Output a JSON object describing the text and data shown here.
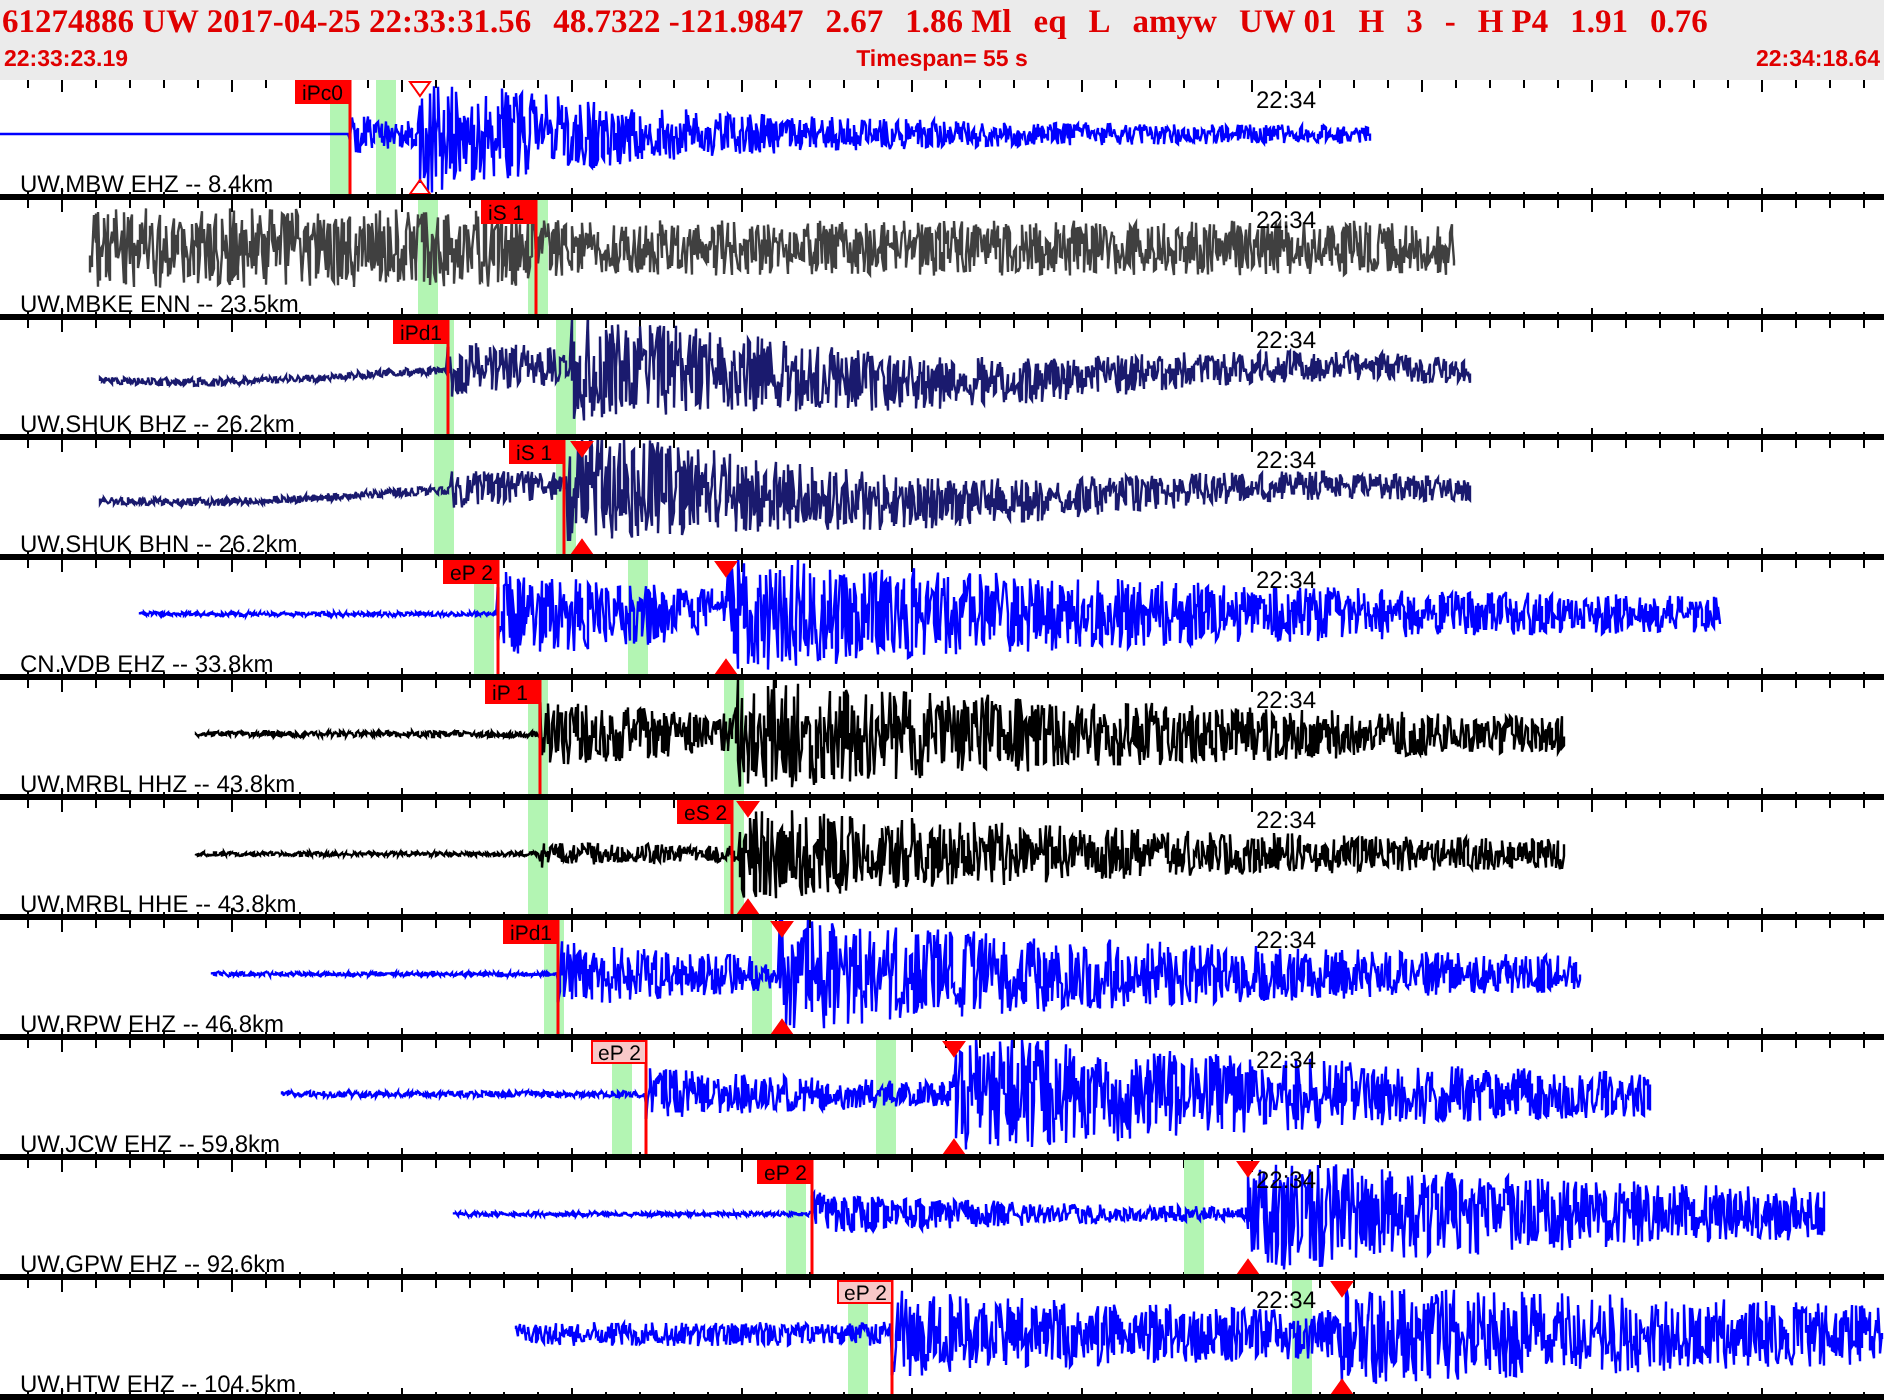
{
  "header": {
    "fields": [
      "61274886 UW 2017-04-25 22:33:31.56",
      "48.7322 -121.9847",
      "2.67",
      "1.86 Ml",
      "eq",
      "L",
      "amyw",
      "UW 01",
      "H",
      "3",
      "-",
      "H P4",
      "1.91",
      "0.76"
    ],
    "start_time": "22:33:23.19",
    "timespan": "Timespan=  55 s",
    "end_time": "22:34:18.64"
  },
  "traces": [
    {
      "station": "UW.MBW EHZ -- 8.4km",
      "time_label": "22:34",
      "color": "#0000ff",
      "pick": {
        "label": "iPc0",
        "kind": "solid"
      }
    },
    {
      "station": "UW.MBKE ENN -- 23.5km",
      "time_label": "22:34",
      "color": "#404040",
      "pick": {
        "label": "iS 1",
        "kind": "solid"
      }
    },
    {
      "station": "UW.SHUK BHZ -- 26.2km",
      "time_label": "22:34",
      "color": "#1a1a6e",
      "pick": {
        "label": "iPd1",
        "kind": "solid"
      }
    },
    {
      "station": "UW.SHUK BHN -- 26.2km",
      "time_label": "22:34",
      "color": "#1a1a6e",
      "pick": {
        "label": "iS 1",
        "kind": "solid"
      }
    },
    {
      "station": "CN.VDB EHZ -- 33.8km",
      "time_label": "22:34",
      "color": "#0000ff",
      "pick": {
        "label": "eP 2",
        "kind": "solid"
      }
    },
    {
      "station": "UW.MRBL HHZ -- 43.8km",
      "time_label": "22:34",
      "color": "#000000",
      "pick": {
        "label": "iP 1",
        "kind": "solid"
      }
    },
    {
      "station": "UW.MRBL HHE -- 43.8km",
      "time_label": "22:34",
      "color": "#000000",
      "pick": {
        "label": "eS 2",
        "kind": "solid"
      }
    },
    {
      "station": "UW.RPW EHZ -- 46.8km",
      "time_label": "22:34",
      "color": "#0000ff",
      "pick": {
        "label": "iPd1",
        "kind": "solid"
      }
    },
    {
      "station": "UW.JCW EHZ -- 59.8km",
      "time_label": "22:34",
      "color": "#0000ff",
      "pick": {
        "label": "eP 2",
        "kind": "pale"
      }
    },
    {
      "station": "UW.GPW EHZ -- 92.6km",
      "time_label": "22:34",
      "color": "#0000ff",
      "pick": {
        "label": "eP 2",
        "kind": "solid"
      }
    },
    {
      "station": "UW.HTW EHZ -- 104.5km",
      "time_label": "22:34",
      "color": "#0000ff",
      "pick": {
        "label": "eP 2",
        "kind": "pale"
      }
    }
  ]
}
